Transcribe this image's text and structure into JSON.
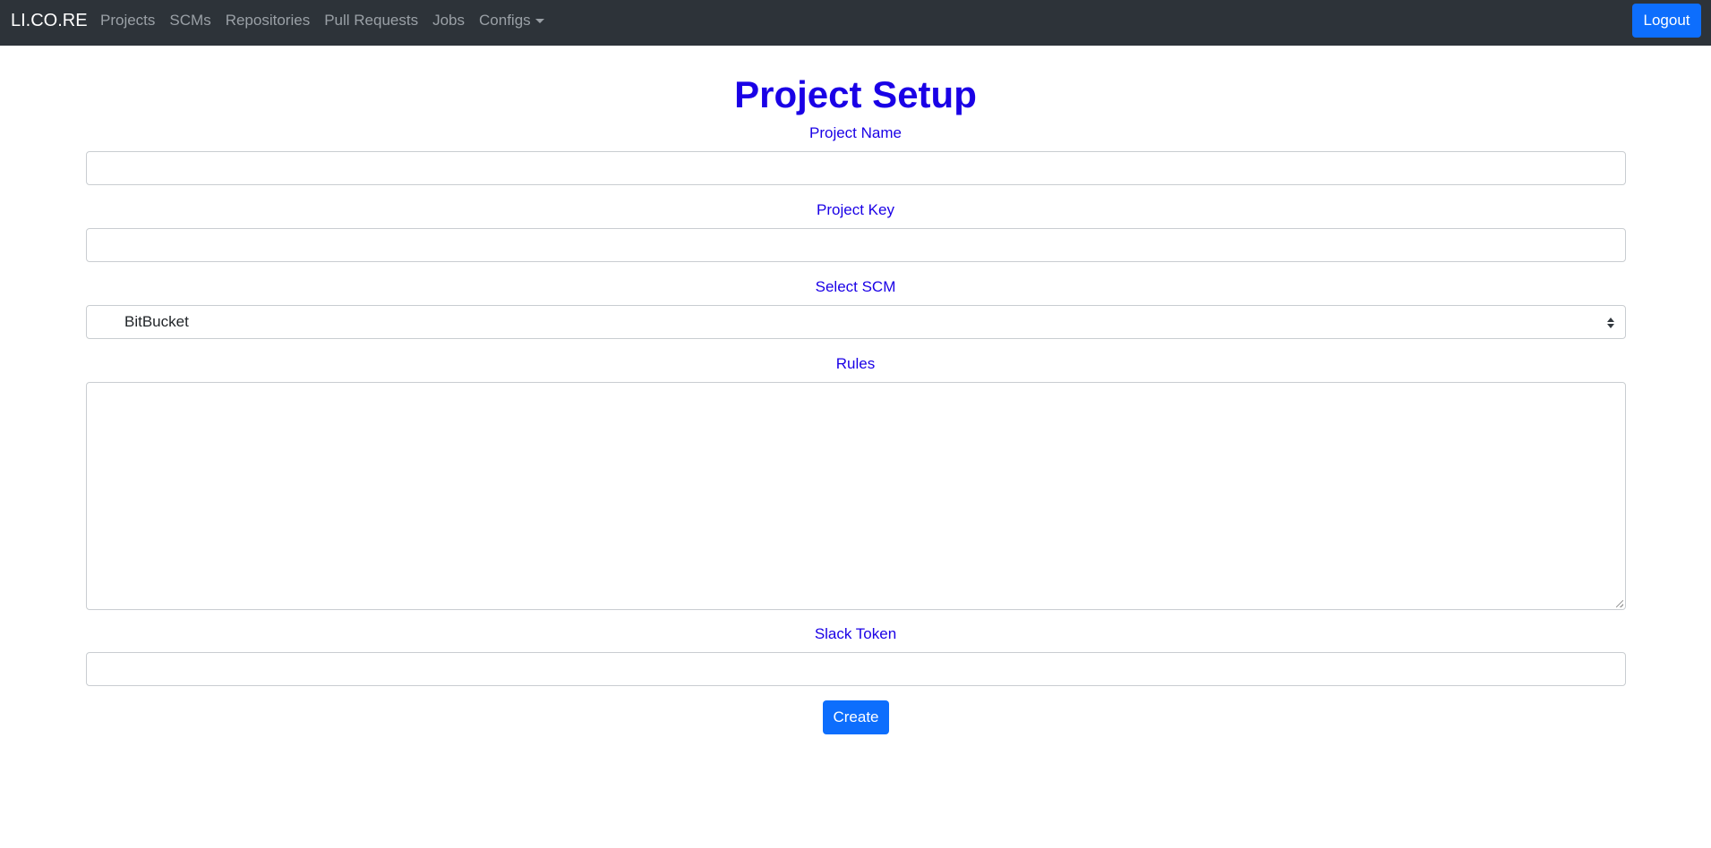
{
  "navbar": {
    "brand": "LI.CO.RE",
    "links": [
      {
        "label": "Projects"
      },
      {
        "label": "SCMs"
      },
      {
        "label": "Repositories"
      },
      {
        "label": "Pull Requests"
      },
      {
        "label": "Jobs"
      },
      {
        "label": "Configs",
        "has_dropdown": true
      }
    ],
    "logout_label": "Logout"
  },
  "form": {
    "title": "Project Setup",
    "project_name": {
      "label": "Project Name",
      "value": "",
      "placeholder": ""
    },
    "project_key": {
      "label": "Project Key",
      "value": "",
      "placeholder": ""
    },
    "scm": {
      "label": "Select SCM",
      "selected": "BitBucket"
    },
    "rules": {
      "label": "Rules",
      "value": ""
    },
    "slack_token": {
      "label": "Slack Token",
      "value": "",
      "placeholder": ""
    },
    "submit_label": "Create"
  },
  "colors": {
    "navbar_bg": "#2d3339",
    "accent": "#0d6efd",
    "label_color": "#1a00e6"
  }
}
